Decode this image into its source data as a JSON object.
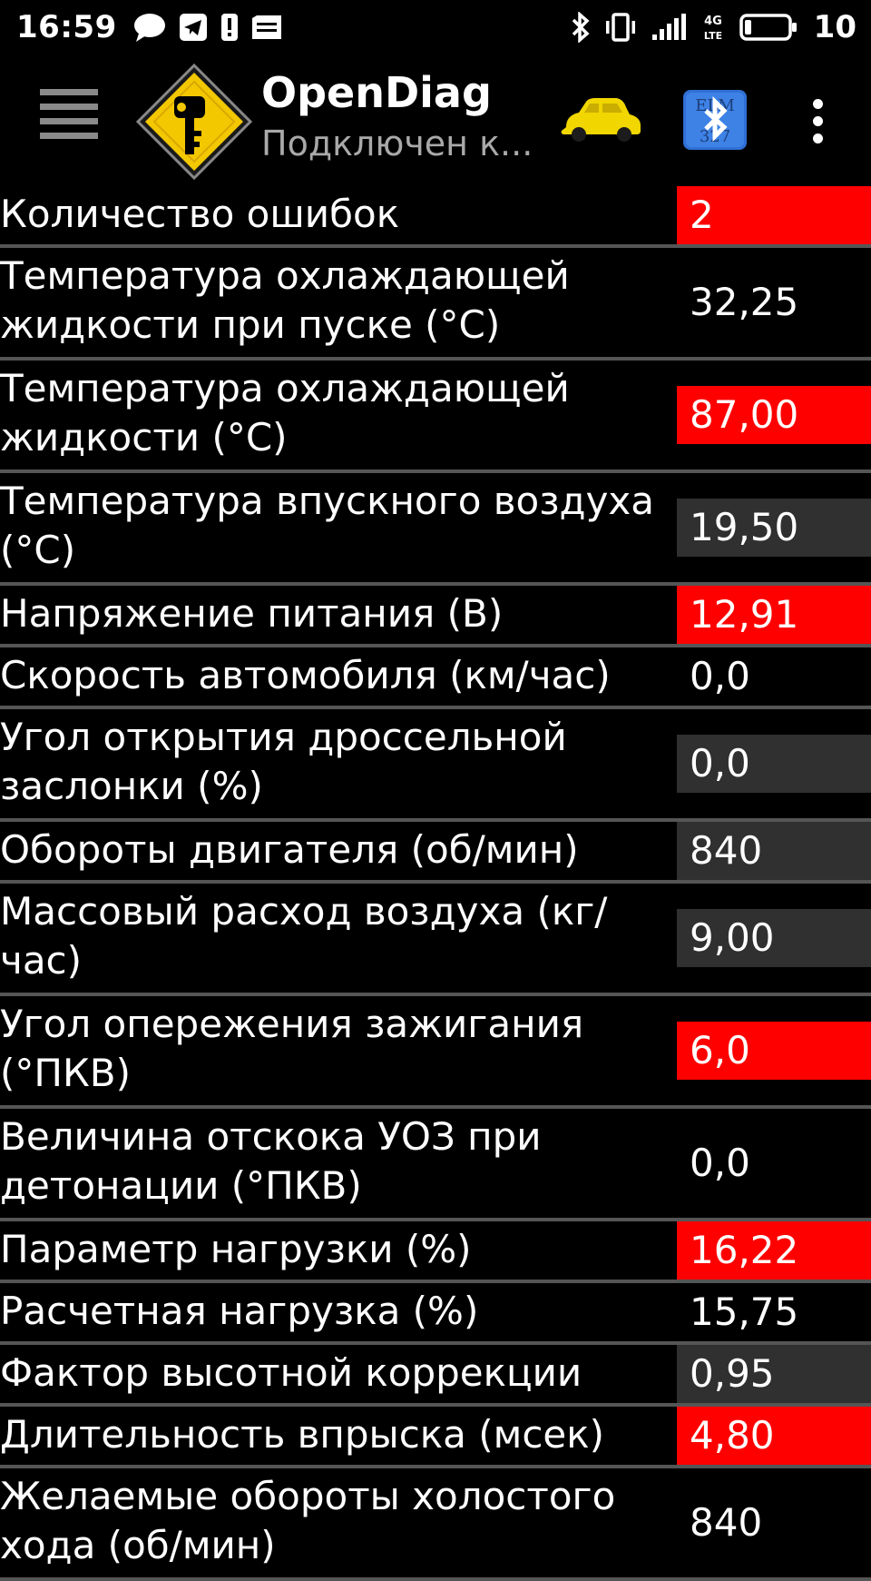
{
  "status_bar": {
    "time": "16:59",
    "battery_level": "10",
    "left_icons": [
      "chat-bubble-icon",
      "telegram-icon",
      "alert-icon",
      "sim-card-icon"
    ],
    "right_icons": [
      "bluetooth-icon",
      "vibrate-icon",
      "signal-icon",
      "lte-icon",
      "battery-icon"
    ],
    "network_label": "4G LTE"
  },
  "app_bar": {
    "title": "OpenDiag",
    "subtitle": "Подключен к...",
    "menu_icon": "hamburger-menu-icon",
    "logo_icon": "key-warning-sign-logo",
    "car_icon": "car-icon",
    "bluetooth_button_icon": "bluetooth-elm327-icon",
    "bluetooth_button_text": "ELM 327",
    "overflow_icon": "more-vert-icon"
  },
  "colors": {
    "alarm": "#ff0000",
    "warn": "#303030",
    "background": "#000000",
    "divider": "#555555",
    "car": "#f1d600",
    "bluetooth_bg": "#2f6fd6"
  },
  "parameters": [
    {
      "label": "Количество ошибок",
      "value": "2",
      "state": "alarm"
    },
    {
      "label": "Температура охлаждающей жидкости при пуске (°C)",
      "value": "32,25",
      "state": "normal"
    },
    {
      "label": "Температура охлаждающей жидкости (°C)",
      "value": "87,00",
      "state": "alarm"
    },
    {
      "label": "Температура впускного воздуха (°C)",
      "value": "19,50",
      "state": "warn"
    },
    {
      "label": "Напряжение питания (В)",
      "value": "12,91",
      "state": "alarm"
    },
    {
      "label": "Скорость автомобиля (км/час)",
      "value": "0,0",
      "state": "normal"
    },
    {
      "label": "Угол открытия дроссельной заслонки (%)",
      "value": "0,0",
      "state": "warn"
    },
    {
      "label": "Обороты двигателя (об/мин)",
      "value": "840",
      "state": "warn"
    },
    {
      "label": "Массовый расход воздуха (кг/час)",
      "value": "9,00",
      "state": "warn"
    },
    {
      "label": "Угол опережения зажигания (°ПКВ)",
      "value": "6,0",
      "state": "alarm"
    },
    {
      "label": "Величина отскока УОЗ при детонации (°ПКВ)",
      "value": "0,0",
      "state": "normal"
    },
    {
      "label": "Параметр нагрузки (%)",
      "value": "16,22",
      "state": "alarm"
    },
    {
      "label": "Расчетная нагрузка (%)",
      "value": "15,75",
      "state": "normal"
    },
    {
      "label": "Фактор высотной коррекции",
      "value": "0,95",
      "state": "warn"
    },
    {
      "label": "Длительность впрыска (мсек)",
      "value": "4,80",
      "state": "alarm"
    },
    {
      "label": "Желаемые обороты холостого хода (об/мин)",
      "value": "840",
      "state": "normal"
    }
  ]
}
